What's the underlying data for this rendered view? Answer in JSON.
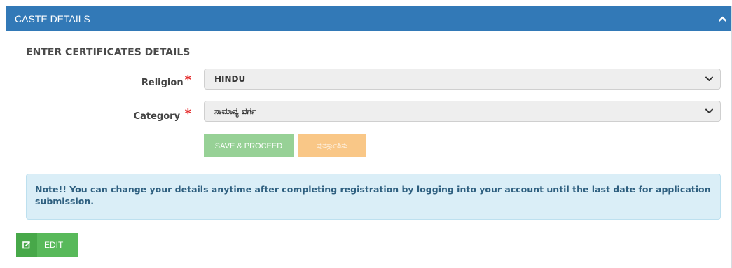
{
  "panel": {
    "title": "CASTE DETAILS",
    "collapse_icon": "chevron-up-icon"
  },
  "form": {
    "section_title": "ENTER CERTIFICATES DETAILS",
    "required_marker": "*",
    "religion": {
      "label": "Religion",
      "selected": "HINDU"
    },
    "category": {
      "label": "Category",
      "selected": "ಸಾಮಾನ್ಯ ವರ್ಗ"
    },
    "buttons": {
      "save_label": "SAVE & PROCEED",
      "reset_label": "ಪುನರ್ಸ್ಥಾಪಿಸು"
    }
  },
  "note": {
    "text": "Note!! You can change your details anytime after completing registration by logging into your account until the last date for application submission."
  },
  "edit_button": {
    "label": "EDIT",
    "icon": "edit-icon"
  },
  "colors": {
    "header": "#3279b7",
    "save_button": "#97d196",
    "reset_button": "#f9c787",
    "note_background": "#daeef7",
    "edit_button": "#58b95a",
    "required": "#e52b2b"
  }
}
